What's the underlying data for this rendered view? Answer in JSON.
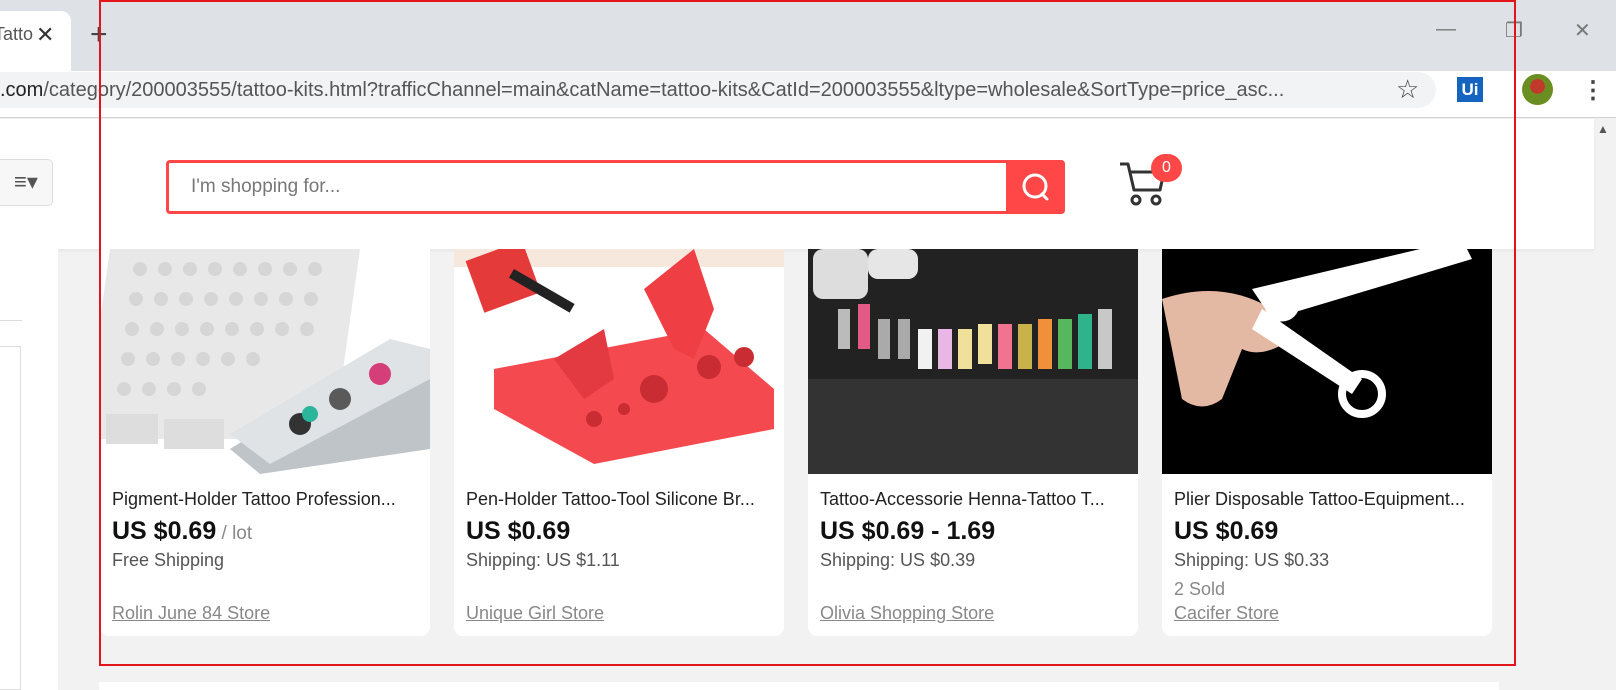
{
  "browser": {
    "tab_title": "Tatto",
    "tab_close_icon": "close-icon",
    "new_tab_label": "+",
    "url_host": ".com",
    "url_path": "/category/200003555/tattoo-kits.html?trafficChannel=main&catName=tattoo-kits&CatId=200003555&ltype=wholesale&SortType=price_asc...",
    "extension_label": "Ui",
    "window_controls": {
      "minimize": "—",
      "restore": "❐",
      "close": "✕"
    }
  },
  "header": {
    "menu_icon": "≡▾",
    "search_placeholder": "I'm shopping for...",
    "cart_count": "0"
  },
  "products": [
    {
      "title": "Pigment-Holder Tattoo Profession...",
      "price": "US $0.69",
      "unit": " / lot",
      "shipping": "Free Shipping",
      "sold": "",
      "store": "Rolin June 84 Store"
    },
    {
      "title": "Pen-Holder Tattoo-Tool Silicone Br...",
      "price": "US $0.69",
      "unit": "",
      "shipping": "Shipping: US $1.11",
      "sold": "",
      "store": "Unique Girl Store"
    },
    {
      "title": "Tattoo-Accessorie Henna-Tattoo T...",
      "price": "US $0.69 - 1.69",
      "unit": "",
      "shipping": "Shipping: US $0.39",
      "sold": "",
      "store": "Olivia Shopping Store"
    },
    {
      "title": "Plier Disposable Tattoo-Equipment...",
      "price": "US $0.69",
      "unit": "",
      "shipping": "Shipping: US $0.33",
      "sold": "2 Sold",
      "store": "Cacifer Store"
    }
  ],
  "colors": {
    "accent": "#ff4747",
    "highlight_border": "#e4141b"
  }
}
